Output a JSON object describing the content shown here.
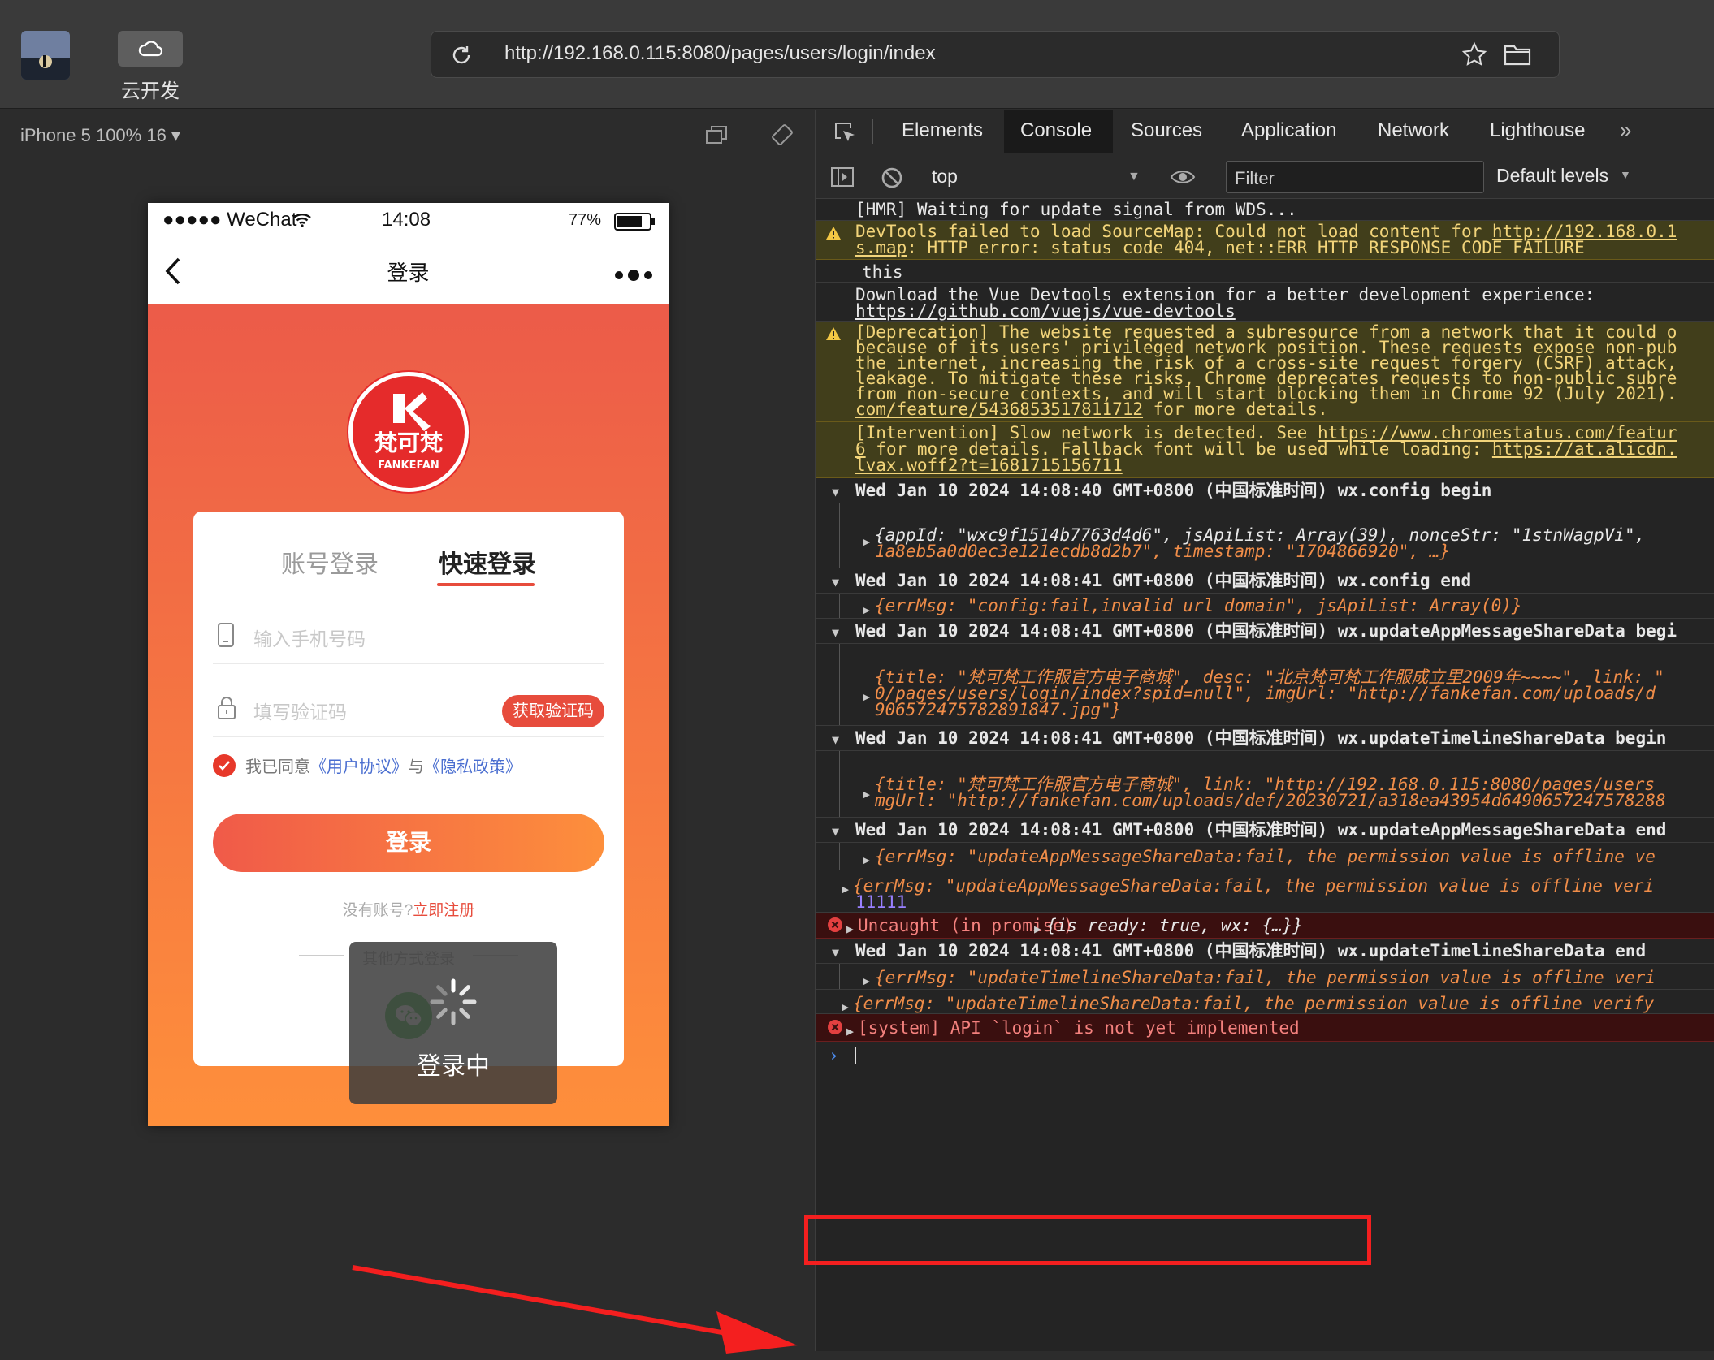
{
  "topbar": {
    "cloud_label": "云开发",
    "url": "http://192.168.0.115:8080/pages/users/login/index"
  },
  "simulator": {
    "device_label": "iPhone 5 100% 16 ▾",
    "status": {
      "signal": "●●●●● WeChat",
      "time": "14:08",
      "battery": "77%"
    },
    "nav_title": "登录",
    "logo_text": "梵可梵",
    "logo_sub": "FANKEFAN",
    "tabs": {
      "account": "账号登录",
      "quick": "快速登录"
    },
    "phone_placeholder": "输入手机号码",
    "code_placeholder": "填写验证码",
    "get_code": "获取验证码",
    "agree": {
      "prefix": "我已同意",
      "terms": "《用户协议》",
      "and": "与",
      "privacy": "《隐私政策》"
    },
    "login_button": "登录",
    "register": {
      "prefix": "没有账号?",
      "link": "立即注册"
    },
    "other_login": "其他方式登录",
    "toast": "登录中"
  },
  "devtools": {
    "tabs": [
      "Elements",
      "Console",
      "Sources",
      "Application",
      "Network",
      "Lighthouse"
    ],
    "active_tab": "Console",
    "more": "»",
    "context": "top",
    "filter_placeholder": "Filter",
    "levels": "Default levels",
    "console": {
      "hmr": "[HMR] Waiting for update signal from WDS...",
      "warn1_l1": "DevTools failed to load SourceMap: Could not load content for ",
      "warn1_url": "http://192.168.0.1",
      "warn1_l2a": "s.map",
      "warn1_l2b": ": HTTP error: status code 404, net::ERR_HTTP_RESPONSE_CODE_FAILURE",
      "this": "this",
      "vue_l1": "Download the Vue Devtools extension for a better development experience:",
      "vue_url": "https://github.com/vuejs/vue-devtools",
      "dep_l1": "[Deprecation] The website requested a subresource from a network that it could o",
      "dep_l2": "because of its users' privileged network position. These requests expose non-pub",
      "dep_l3": "the internet, increasing the risk of a cross-site request forgery (CSRF) attack,",
      "dep_l4": "leakage. To mitigate these risks, Chrome deprecates requests to non-public subre",
      "dep_l5": "from non-secure contexts, and will start blocking them in Chrome 92 (July 2021).",
      "dep_l6_url": "com/feature/5436853517811712",
      "dep_l6_rest": " for more details.",
      "int_l1a": "[Intervention] Slow network is detected. See ",
      "int_l1_url": "https://www.chromestatus.com/featur",
      "int_l2a": "6",
      "int_l2b": " for more details. Fallback font will be used while loading: ",
      "int_l2_url": "https://at.alicdn.",
      "int_l3_url": "lvax.woff2?t=1681715156711",
      "g1": "Wed Jan 10 2024 14:08:40 GMT+0800 (中国标准时间) wx.config begin",
      "g1_obj_l1": "{appId: \"wxc9f1514b7763d4d6\", jsApiList: Array(39), nonceStr: \"1stnWagpVi\",",
      "g1_obj_l2": "1a8eb5a0d0ec3e121ecdb8d2b7\", timestamp: \"1704866920\", …}",
      "g2": "Wed Jan 10 2024 14:08:41 GMT+0800 (中国标准时间) wx.config end",
      "g2_obj": "{errMsg: \"config:fail,invalid url domain\", jsApiList: Array(0)}",
      "g3": "Wed Jan 10 2024 14:08:41 GMT+0800 (中国标准时间) wx.updateAppMessageShareData begi",
      "g3_obj_l1": "{title: \"梵可梵工作服官方电子商城\", desc: \"北京梵可梵工作服成立里2009年~~~~\", link: \"",
      "g3_obj_l2": "0/pages/users/login/index?spid=null\", imgUrl: \"http://fankefan.com/uploads/d",
      "g3_obj_l3": "906572475782891847.jpg\"}",
      "g4": "Wed Jan 10 2024 14:08:41 GMT+0800 (中国标准时间) wx.updateTimelineShareData begin",
      "g4_obj_l1": "{title: \"梵可梵工作服官方电子商城\", link: \"http://192.168.0.115:8080/pages/users",
      "g4_obj_l2": "mgUrl: \"http://fankefan.com/uploads/def/20230721/a318ea43954d6490657247578288",
      "g5": "Wed Jan 10 2024 14:08:41 GMT+0800 (中国标准时间) wx.updateAppMessageShareData end",
      "g5_obj": "{errMsg: \"updateAppMessageShareData:fail, the permission value is offline ve",
      "log1": "{errMsg: \"updateAppMessageShareData:fail, the permission value is offline veri",
      "log1_num": "11111",
      "err1_a": "Uncaught (in promise) ",
      "err1_b": "{is_ready: true, wx: {…}}",
      "g6": "Wed Jan 10 2024 14:08:41 GMT+0800 (中国标准时间) wx.updateTimelineShareData end",
      "g6_obj": "{errMsg: \"updateTimelineShareData:fail, the permission value is offline veri",
      "log2": "{errMsg: \"updateTimelineShareData:fail, the permission value is offline verify",
      "err2": "[system] API `login` is not yet implemented"
    }
  },
  "colors": {
    "accent": "#e74c3c",
    "highlight": "#f41f1f",
    "warn_bg": "#413e1b",
    "err_bg": "#3a0f0f"
  }
}
